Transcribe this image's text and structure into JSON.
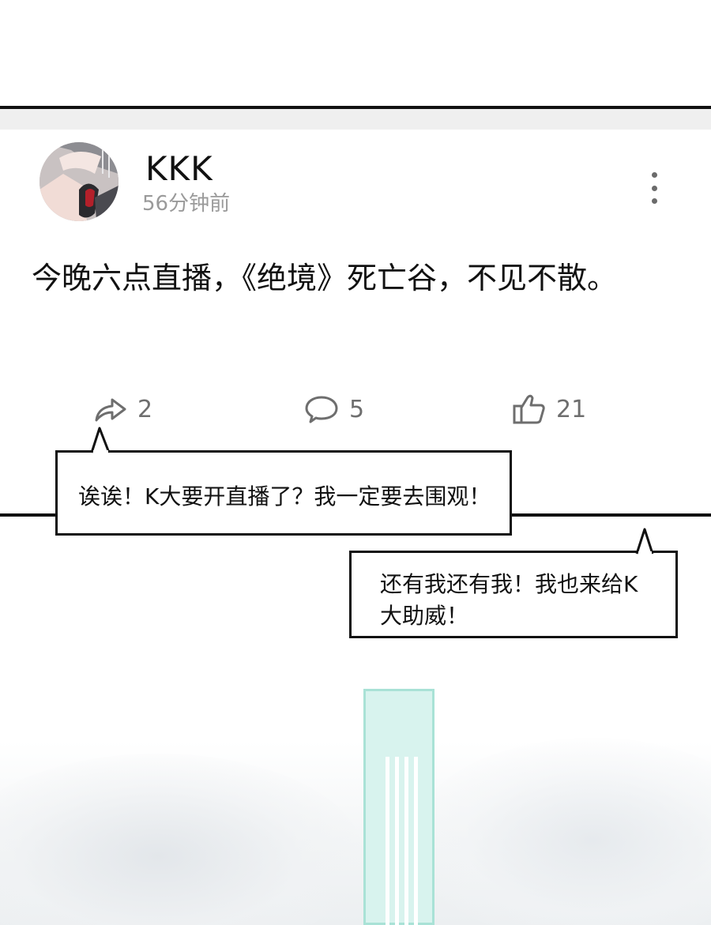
{
  "post": {
    "username": "KKK",
    "timestamp": "56分钟前",
    "text": "今晚六点直播，《绝境》死亡谷，不见不散。",
    "actions": {
      "share_count": "2",
      "comment_count": "5",
      "like_count": "21"
    }
  },
  "bubbles": {
    "first": "诶诶！K大要开直播了？我一定要去围观！",
    "second_line1": "还有我还有我！我也来给K",
    "second_line2": "大助威！"
  },
  "icons": {
    "avatar": "avatar-image",
    "more": "more-vertical-icon",
    "share": "share-icon",
    "comment": "comment-icon",
    "like": "thumbs-up-icon"
  },
  "colors": {
    "text_primary": "#111111",
    "text_secondary": "#9a9a9a",
    "icon_gray": "#6e6e6e",
    "beam": "#d8f3ee"
  }
}
